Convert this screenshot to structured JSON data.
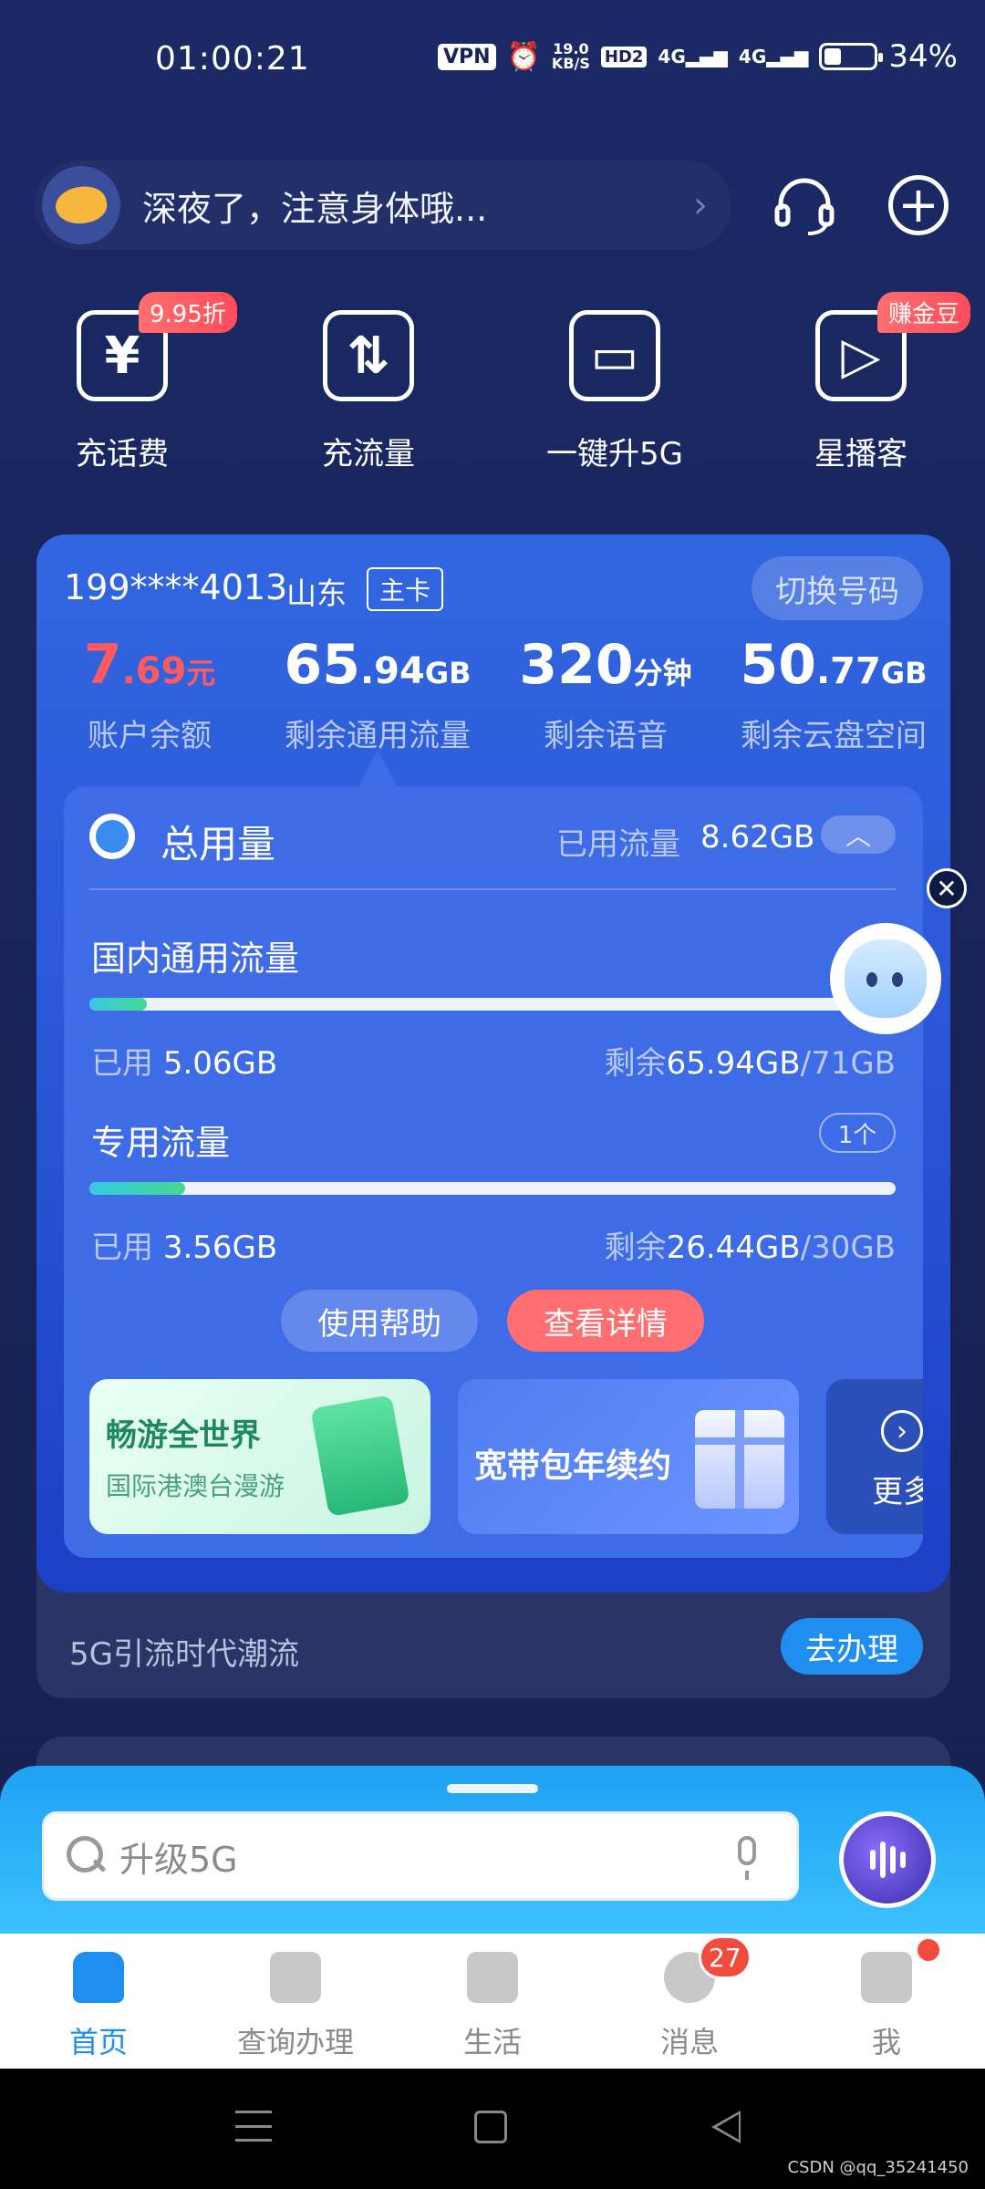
{
  "status_bar": {
    "time": "01:00:21",
    "vpn": "VPN",
    "speed_value": "19.0",
    "speed_unit": "KB/S",
    "hd": "HD2",
    "network1": "4G",
    "network2": "4G",
    "battery": "34%"
  },
  "greeting": {
    "text": "深夜了，注意身体哦...",
    "arrow": "›"
  },
  "quick_actions": [
    {
      "label": "充话费",
      "badge": "9.95折",
      "icon": "¥"
    },
    {
      "label": "充流量",
      "icon": "⇅"
    },
    {
      "label": "一键升5G",
      "icon": "▭"
    },
    {
      "label": "星播客",
      "badge": "赚金豆",
      "icon": "▷"
    }
  ],
  "account": {
    "number": "199****4013",
    "region": "山东",
    "card_type": "主卡",
    "switch_label": "切换号码"
  },
  "stats": [
    {
      "int": "7",
      "dec": ".69",
      "unit": "元",
      "label": "账户余额"
    },
    {
      "int": "65",
      "dec": ".94",
      "unit": "GB",
      "label": "剩余通用流量"
    },
    {
      "int": "320",
      "dec": "",
      "unit": "分钟",
      "label": "剩余语音"
    },
    {
      "int": "50",
      "dec": ".77",
      "unit": "GB",
      "label": "剩余云盘空间"
    }
  ],
  "usage_panel": {
    "title": "总用量",
    "used_label": "已用流量",
    "used_value": "8.62GB",
    "rows": [
      {
        "title": "国内通用流量",
        "used_prefix": "已用",
        "used": "5.06GB",
        "remain_prefix": "剩余",
        "remain": "65.94GB",
        "total": "/71GB",
        "progress": 0.071
      },
      {
        "title": "专用流量",
        "count": "1个",
        "used_prefix": "已用",
        "used": "3.56GB",
        "remain_prefix": "剩余",
        "remain": "26.44GB",
        "total": "/30GB",
        "progress": 0.119
      }
    ],
    "help_button": "使用帮助",
    "detail_button": "查看详情"
  },
  "promos": [
    {
      "title": "畅游全世界",
      "subtitle": "国际港澳台漫游"
    },
    {
      "title": "宽带包年续约"
    },
    {
      "title": "更多"
    }
  ],
  "banner": {
    "text": "5G引流时代潮流",
    "button": "去办理"
  },
  "search": {
    "placeholder": "升级5G"
  },
  "nav": [
    {
      "label": "首页",
      "active": true
    },
    {
      "label": "查询办理"
    },
    {
      "label": "生活"
    },
    {
      "label": "消息",
      "badge": "27"
    },
    {
      "label": "我",
      "dot": true
    }
  ],
  "watermark": "CSDN @qq_35241450",
  "colors": {
    "accent": "#1e8ef0",
    "card": "#2a56d6",
    "danger": "#ff5a5f"
  }
}
